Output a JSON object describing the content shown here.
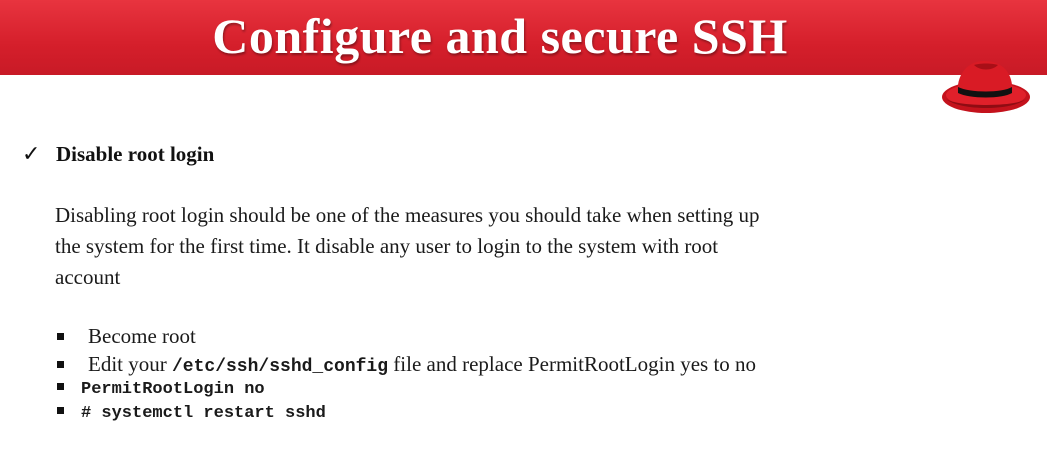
{
  "slide": {
    "title": "Configure and secure SSH",
    "accent_color": "#d51f2b",
    "logo_icon": "red-fedora-hat-icon"
  },
  "section": {
    "check_icon": "checkmark-icon",
    "check_glyph": "✓",
    "heading": "Disable root login",
    "paragraph_lines": [
      "Disabling root login should be one of the measures you should take when setting up",
      "the system for the first time.  It disable any user to login to the system with root",
      "account"
    ]
  },
  "bullets": {
    "item1": "Become root",
    "item2_before": "Edit your ",
    "item2_code": "/etc/ssh/sshd_config",
    "item2_after": " file and replace PermitRootLogin yes to no",
    "item3": "PermitRootLogin no",
    "item4": "# systemctl restart sshd"
  }
}
